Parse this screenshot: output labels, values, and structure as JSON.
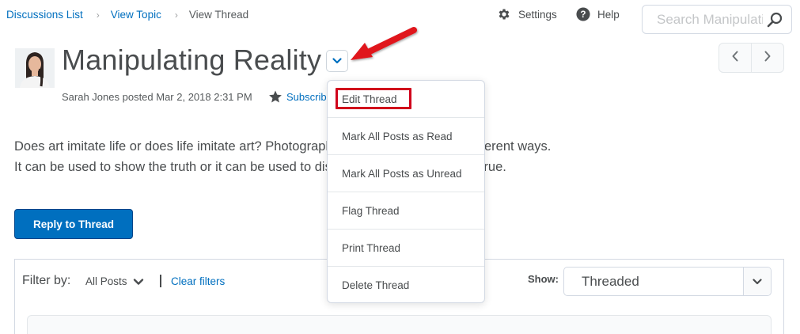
{
  "breadcrumb": {
    "items": [
      {
        "label": "Discussions List"
      },
      {
        "label": "View Topic"
      }
    ],
    "current": "View Thread",
    "separator": "›"
  },
  "header": {
    "settings_label": "Settings",
    "help_label": "Help",
    "search_placeholder": "Search Manipulating Reality"
  },
  "thread": {
    "title": "Manipulating Reality",
    "meta": "Sarah Jones posted Mar 2, 2018 2:31 PM",
    "subscribe_label": "Subscribe",
    "body": "Does art imitate life or does life imitate art? Photography can be used in many different ways. It can be used to show the truth or it can be used to distort what was known was true.",
    "reply_label": "Reply to Thread"
  },
  "dropdown_menu": {
    "items": [
      {
        "label": "Edit Thread",
        "highlighted": true
      },
      {
        "label": "Mark All Posts as Read"
      },
      {
        "label": "Mark All Posts as Unread"
      },
      {
        "label": "Flag Thread"
      },
      {
        "label": "Print Thread"
      },
      {
        "label": "Delete Thread"
      }
    ]
  },
  "filters": {
    "filter_by_label": "Filter by:",
    "filter_value": "All Posts",
    "clear_label": "Clear filters",
    "show_label": "Show:",
    "show_value": "Threaded"
  },
  "colors": {
    "link": "#006fbf",
    "primary_button": "#006fbf",
    "annotation_red": "#d0021b",
    "text": "#494c4e"
  },
  "icons": {
    "settings": "gear-icon",
    "help": "help-icon",
    "search": "search-icon",
    "subscribe": "star-icon",
    "title_menu": "chevron-down-icon",
    "prev": "chevron-left-icon",
    "next": "chevron-right-icon"
  }
}
